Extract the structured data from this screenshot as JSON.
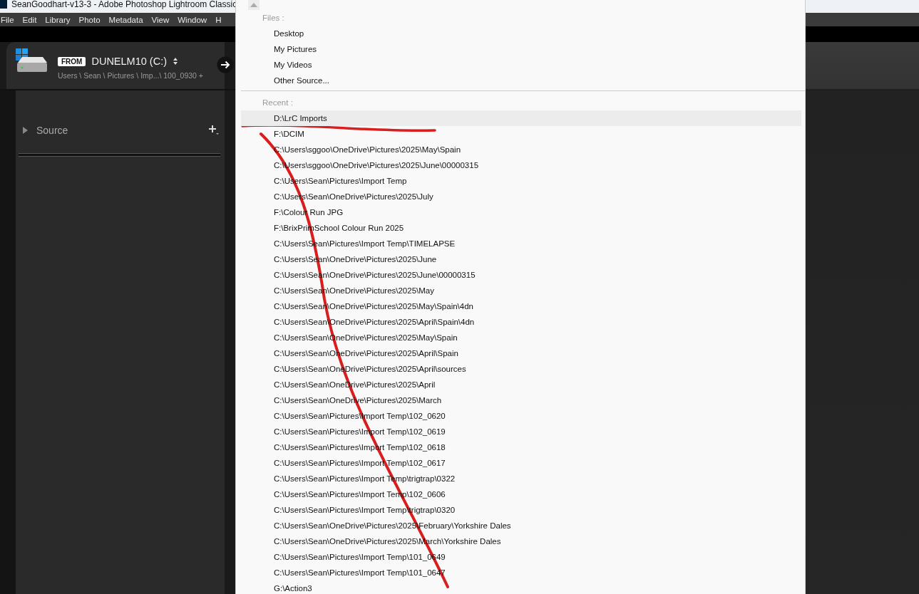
{
  "window": {
    "title": "SeanGoodhart-v13-3 - Adobe Photoshop Lightroom Classic"
  },
  "menu": [
    "File",
    "Edit",
    "Library",
    "Photo",
    "Metadata",
    "View",
    "Window",
    "H"
  ],
  "import_header": {
    "from_badge": "FROM",
    "drive": "DUNELM10 (C:)",
    "path": "Users \\ Sean \\ Pictures \\ Imp...\\ 100_0930 +"
  },
  "source_panel": {
    "title": "Source",
    "expanded": false
  },
  "source_menu": {
    "files_header": "Files :",
    "files": [
      "Desktop",
      "My Pictures",
      "My Videos",
      "Other Source..."
    ],
    "recent_header": "Recent :",
    "recent": [
      {
        "label": "D:\\LrC Imports",
        "selected": true
      },
      {
        "label": "F:\\DCIM",
        "selected": false
      },
      {
        "label": "C:\\Users\\sggoo\\OneDrive\\Pictures\\2025\\May\\Spain",
        "selected": false
      },
      {
        "label": "C:\\Users\\sggoo\\OneDrive\\Pictures\\2025\\June\\00000315",
        "selected": false
      },
      {
        "label": "C:\\Users\\Sean\\Pictures\\Import Temp",
        "selected": false
      },
      {
        "label": "C:\\Users\\Sean\\OneDrive\\Pictures\\2025\\July",
        "selected": false
      },
      {
        "label": "F:\\Colour Run JPG",
        "selected": false
      },
      {
        "label": "F:\\BrixPrimSchool Colour Run 2025",
        "selected": false
      },
      {
        "label": "C:\\Users\\Sean\\Pictures\\Import Temp\\TIMELAPSE",
        "selected": false
      },
      {
        "label": "C:\\Users\\Sean\\OneDrive\\Pictures\\2025\\June",
        "selected": false
      },
      {
        "label": "C:\\Users\\Sean\\OneDrive\\Pictures\\2025\\June\\00000315",
        "selected": false
      },
      {
        "label": "C:\\Users\\Sean\\OneDrive\\Pictures\\2025\\May",
        "selected": false
      },
      {
        "label": "C:\\Users\\Sean\\OneDrive\\Pictures\\2025\\May\\Spain\\4dn",
        "selected": false
      },
      {
        "label": "C:\\Users\\Sean\\OneDrive\\Pictures\\2025\\April\\Spain\\4dn",
        "selected": false
      },
      {
        "label": "C:\\Users\\Sean\\OneDrive\\Pictures\\2025\\May\\Spain",
        "selected": false
      },
      {
        "label": "C:\\Users\\Sean\\OneDrive\\Pictures\\2025\\April\\Spain",
        "selected": false
      },
      {
        "label": "C:\\Users\\Sean\\OneDrive\\Pictures\\2025\\April\\sources",
        "selected": false
      },
      {
        "label": "C:\\Users\\Sean\\OneDrive\\Pictures\\2025\\April",
        "selected": false
      },
      {
        "label": "C:\\Users\\Sean\\OneDrive\\Pictures\\2025\\March",
        "selected": false
      },
      {
        "label": "C:\\Users\\Sean\\Pictures\\Import Temp\\102_0620",
        "selected": false
      },
      {
        "label": "C:\\Users\\Sean\\Pictures\\Import Temp\\102_0619",
        "selected": false
      },
      {
        "label": "C:\\Users\\Sean\\Pictures\\Import Temp\\102_0618",
        "selected": false
      },
      {
        "label": "C:\\Users\\Sean\\Pictures\\Import Temp\\102_0617",
        "selected": false
      },
      {
        "label": "C:\\Users\\Sean\\Pictures\\Import Temp\\trigtrap\\0322",
        "selected": false
      },
      {
        "label": "C:\\Users\\Sean\\Pictures\\Import Temp\\102_0606",
        "selected": false
      },
      {
        "label": "C:\\Users\\Sean\\Pictures\\Import Temp\\trigtrap\\0320",
        "selected": false
      },
      {
        "label": "C:\\Users\\Sean\\OneDrive\\Pictures\\2025\\February\\Yorkshire Dales",
        "selected": false
      },
      {
        "label": "C:\\Users\\Sean\\OneDrive\\Pictures\\2025\\March\\Yorkshire Dales",
        "selected": false
      },
      {
        "label": "C:\\Users\\Sean\\Pictures\\Import Temp\\101_0649",
        "selected": false
      },
      {
        "label": "C:\\Users\\Sean\\Pictures\\Import Temp\\101_0647",
        "selected": false
      },
      {
        "label": "G:\\Action3",
        "selected": false
      }
    ]
  }
}
